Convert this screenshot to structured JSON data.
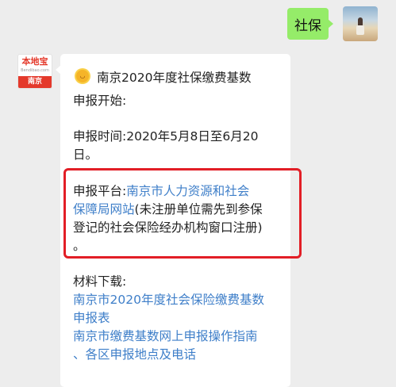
{
  "chat": {
    "me": {
      "message": "社保"
    },
    "account": {
      "logo_text": "本地宝",
      "logo_domain": "Bendibao.com",
      "city_label": "南京"
    },
    "article": {
      "title": "南京2020年度社保缴费基数",
      "start_heading": "申报开始:",
      "time_line1": "申报时间:2020年5月8日至6月20",
      "time_line2": "日。",
      "platform_prefix": "申报平台:",
      "platform_link_part1": "南京市人力资源和社会",
      "platform_link_part2": "保障局网站",
      "platform_note_part1": "(未注册单位需先到参保",
      "platform_note_line2": "登记的社会保险经办机构窗口注册)",
      "platform_note_line3": "。",
      "materials_heading": "材料下载:",
      "material_link1_line1": "南京市2020年度社会保险缴费基数",
      "material_link1_line2": "申报表",
      "material_link2_line1": "南京市缴费基数网上申报操作指南",
      "material_link2_line2": "、各区申报地点及电话"
    }
  },
  "colors": {
    "accent_green": "#95ec69",
    "link_blue": "#3f7fc9",
    "highlight_red": "#e21e26",
    "brand_red": "#e4392b"
  }
}
